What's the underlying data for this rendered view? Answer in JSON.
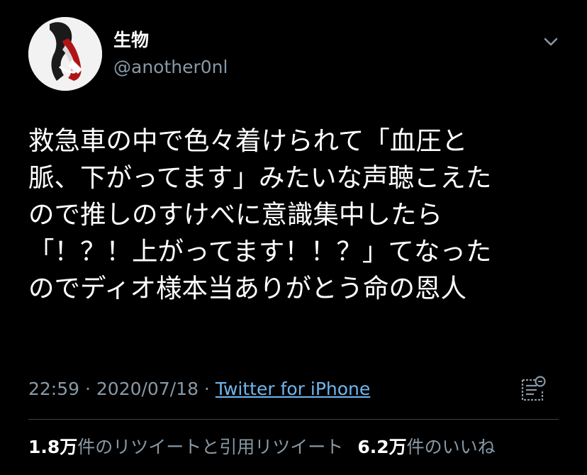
{
  "author": {
    "display_name": "生物",
    "handle": "@another0nl"
  },
  "tweet": {
    "lines": [
      "救急車の中で色々着けられて「血圧と",
      "脈、下がってます」みたいな声聴こえた",
      "ので推しのすけべに意識集中したら",
      "「！？！上がってます！！？」てなった",
      "のでディオ様本当ありがとう命の恩人"
    ],
    "time": "22:59",
    "separator": " · ",
    "date": "2020/07/18",
    "source": "Twitter for iPhone"
  },
  "stats": {
    "retweets_count": "1.8万",
    "retweets_label": "件のリツイートと引用リツイート",
    "likes_count": "6.2万",
    "likes_label": "件のいいね"
  },
  "icons": {
    "menu": "chevron-down-icon",
    "analytics": "analytics-icon"
  },
  "colors": {
    "background": "#000000",
    "text": "#ffffff",
    "secondary": "#8899a6",
    "link": "#6fb6ef",
    "divider": "#38444d"
  }
}
